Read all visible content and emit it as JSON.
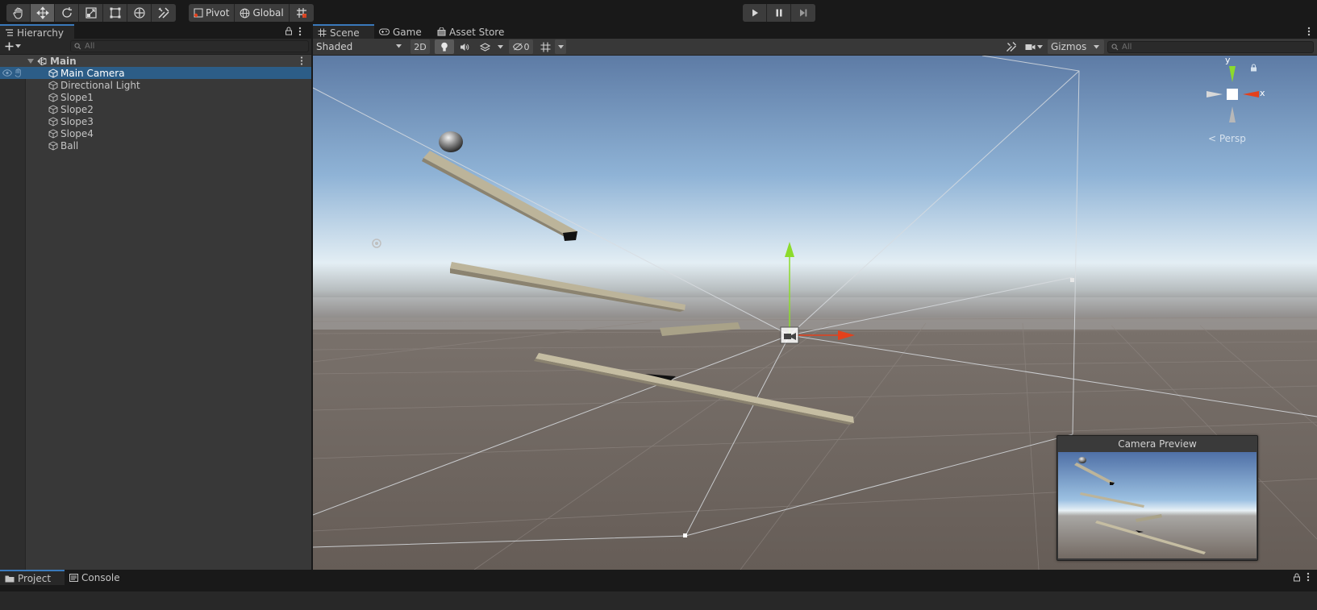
{
  "toolbar": {
    "tools": [
      "hand-tool",
      "move-tool",
      "rotate-tool",
      "scale-tool",
      "rect-tool",
      "transform-tool",
      "custom-tool"
    ],
    "pivot_label": "Pivot",
    "global_label": "Global",
    "play_controls": [
      "play",
      "pause",
      "step"
    ]
  },
  "hierarchy": {
    "tab_label": "Hierarchy",
    "search_placeholder": "All",
    "scene_name": "Main",
    "items": [
      {
        "label": "Main Camera",
        "selected": true
      },
      {
        "label": "Directional Light"
      },
      {
        "label": "Slope1"
      },
      {
        "label": "Slope2"
      },
      {
        "label": "Slope3"
      },
      {
        "label": "Slope4"
      },
      {
        "label": "Ball"
      }
    ]
  },
  "scene_tabs": [
    {
      "label": "Scene",
      "icon": "grid-icon",
      "active": true
    },
    {
      "label": "Game",
      "icon": "gamepad-icon"
    },
    {
      "label": "Asset Store",
      "icon": "store-icon"
    }
  ],
  "scene_toolbar": {
    "shading_mode": "Shaded",
    "mode_2d": "2D",
    "hidden_count": "0",
    "gizmos_label": "Gizmos",
    "search_placeholder": "All"
  },
  "orientation_gizmo": {
    "y_label": "y",
    "x_label": "x",
    "projection_label": "< Persp"
  },
  "camera_preview": {
    "title": "Camera Preview"
  },
  "bottom_tabs": [
    {
      "label": "Project",
      "icon": "folder-icon",
      "active": true
    },
    {
      "label": "Console",
      "icon": "console-icon"
    }
  ],
  "colors": {
    "selection": "#2c5d87",
    "tab_accent": "#3a79bb",
    "x_axis": "#e3411c",
    "y_axis": "#8cdb2c",
    "slope": "#bcb49a"
  }
}
